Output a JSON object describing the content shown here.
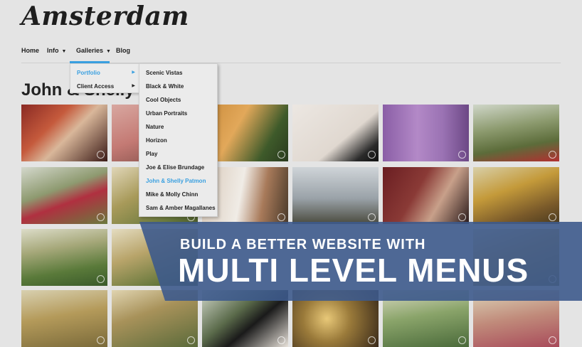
{
  "site": {
    "logo": "Amsterdam"
  },
  "nav": {
    "items": [
      {
        "label": "Home",
        "has_dropdown": false
      },
      {
        "label": "Info",
        "has_dropdown": true
      },
      {
        "label": "Galleries",
        "has_dropdown": true,
        "active": true
      },
      {
        "label": "Blog",
        "has_dropdown": false
      }
    ],
    "accent_color": "#3aa0e0"
  },
  "page": {
    "title": "John & Shelly P"
  },
  "galleries_menu": {
    "items": [
      {
        "label": "Portfolio",
        "active": true,
        "has_submenu": true
      },
      {
        "label": "Client Access",
        "active": false,
        "has_submenu": true
      }
    ]
  },
  "portfolio_submenu": {
    "items": [
      {
        "label": "Scenic Vistas"
      },
      {
        "label": "Black & White"
      },
      {
        "label": "Cool Objects"
      },
      {
        "label": "Urban Portraits"
      },
      {
        "label": "Nature"
      },
      {
        "label": "Horizon"
      },
      {
        "label": "Play"
      },
      {
        "label": "Joe & Elise Brundage"
      },
      {
        "label": "John & Shelly Patmon",
        "active": true
      },
      {
        "label": "Mike & Molly Chinn"
      },
      {
        "label": "Sam & Amber Magallanes"
      }
    ]
  },
  "banner": {
    "line1": "BUILD A BETTER WEBSITE WITH",
    "line2": "MULTI LEVEL MENUS",
    "color": "#3d5a8c"
  },
  "thumbnails": [
    {
      "subject": "bride in mirror"
    },
    {
      "subject": "flowers"
    },
    {
      "subject": "lantern"
    },
    {
      "subject": "amore sign"
    },
    {
      "subject": "la villa sign"
    },
    {
      "subject": "red phone booth"
    },
    {
      "subject": "bride at phone booth"
    },
    {
      "subject": "bride in garden"
    },
    {
      "subject": "bride in doorway"
    },
    {
      "subject": "bare tree"
    },
    {
      "subject": "bride at mirror"
    },
    {
      "subject": "autumn trees"
    },
    {
      "subject": "couple walking"
    },
    {
      "subject": "couple in trees"
    },
    {
      "subject": "couple kissing"
    },
    {
      "subject": "bokeh lights"
    },
    {
      "subject": "couple in field"
    },
    {
      "subject": "bridal party"
    }
  ]
}
